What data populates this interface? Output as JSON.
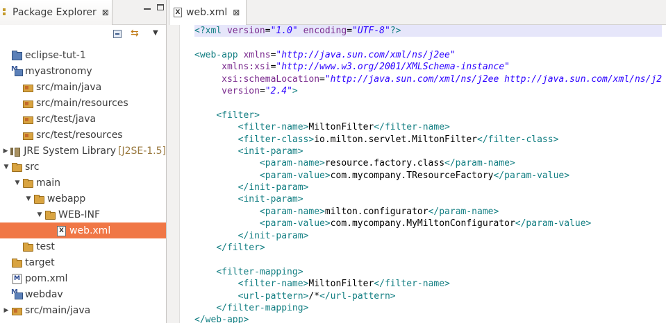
{
  "explorer": {
    "title": "Package Explorer",
    "close": "⊠",
    "tree": [
      {
        "label": "eclipse-tut-1",
        "icon": "project-icon",
        "depth": 0,
        "arrow": "",
        "suffix": ""
      },
      {
        "label": "myastronomy",
        "icon": "maven-project-icon",
        "depth": 0,
        "arrow": "",
        "suffix": ""
      },
      {
        "label": "src/main/java",
        "icon": "source-folder-icon",
        "depth": 1,
        "arrow": "",
        "suffix": ""
      },
      {
        "label": "src/main/resources",
        "icon": "source-folder-icon",
        "depth": 1,
        "arrow": "",
        "suffix": ""
      },
      {
        "label": "src/test/java",
        "icon": "source-folder-icon",
        "depth": 1,
        "arrow": "",
        "suffix": ""
      },
      {
        "label": "src/test/resources",
        "icon": "source-folder-icon",
        "depth": 1,
        "arrow": "",
        "suffix": ""
      },
      {
        "label": "JRE System Library",
        "icon": "library-icon",
        "depth": 0,
        "arrow": "▶",
        "suffix": "[J2SE-1.5]"
      },
      {
        "label": "src",
        "icon": "folder-icon",
        "depth": 0,
        "arrow": "▼",
        "suffix": ""
      },
      {
        "label": "main",
        "icon": "folder-icon",
        "depth": 1,
        "arrow": "▼",
        "suffix": ""
      },
      {
        "label": "webapp",
        "icon": "folder-icon",
        "depth": 2,
        "arrow": "▼",
        "suffix": ""
      },
      {
        "label": "WEB-INF",
        "icon": "folder-icon",
        "depth": 3,
        "arrow": "▼",
        "suffix": ""
      },
      {
        "label": "web.xml",
        "icon": "xml-file-icon",
        "depth": 4,
        "arrow": "",
        "suffix": "",
        "selected": true
      },
      {
        "label": "test",
        "icon": "folder-icon",
        "depth": 1,
        "arrow": "",
        "suffix": ""
      },
      {
        "label": "target",
        "icon": "folder-icon",
        "depth": 0,
        "arrow": "",
        "suffix": ""
      },
      {
        "label": "pom.xml",
        "icon": "pom-file-icon",
        "depth": 0,
        "arrow": "",
        "suffix": ""
      },
      {
        "label": "webdav",
        "icon": "maven-project-icon",
        "depth": 0,
        "arrow": "",
        "suffix": ""
      },
      {
        "label": "src/main/java",
        "icon": "source-folder-icon",
        "depth": 0,
        "arrow": "▶",
        "suffix": ""
      }
    ]
  },
  "editor": {
    "tab_title": "web.xml",
    "tab_close": "⊠",
    "file_icon": "X",
    "lines": [
      [
        [
          "pi",
          "<?xml "
        ],
        [
          "attr",
          "version"
        ],
        [
          "txt",
          "="
        ],
        [
          "val",
          "\"1.0\""
        ],
        [
          "txt",
          " "
        ],
        [
          "attr",
          "encoding"
        ],
        [
          "txt",
          "="
        ],
        [
          "val",
          "\"UTF-8\""
        ],
        [
          "pi",
          "?>"
        ]
      ],
      [],
      [
        [
          "tag",
          "<web-app "
        ],
        [
          "attr",
          "xmlns"
        ],
        [
          "txt",
          "="
        ],
        [
          "val",
          "\"http://java.sun.com/xml/ns/j2ee\""
        ]
      ],
      [
        [
          "txt",
          "     "
        ],
        [
          "attr",
          "xmlns:xsi"
        ],
        [
          "txt",
          "="
        ],
        [
          "val",
          "\"http://www.w3.org/2001/XMLSchema-instance\""
        ]
      ],
      [
        [
          "txt",
          "     "
        ],
        [
          "attr",
          "xsi:schemaLocation"
        ],
        [
          "txt",
          "="
        ],
        [
          "val",
          "\"http://java.sun.com/xml/ns/j2ee http://java.sun.com/xml/ns/j2"
        ]
      ],
      [
        [
          "txt",
          "     "
        ],
        [
          "attr",
          "version"
        ],
        [
          "txt",
          "="
        ],
        [
          "val",
          "\"2.4\""
        ],
        [
          "tag",
          ">"
        ]
      ],
      [],
      [
        [
          "txt",
          "    "
        ],
        [
          "tag",
          "<filter>"
        ]
      ],
      [
        [
          "txt",
          "        "
        ],
        [
          "tag",
          "<filter-name>"
        ],
        [
          "txt",
          "MiltonFilter"
        ],
        [
          "tag",
          "</filter-name>"
        ]
      ],
      [
        [
          "txt",
          "        "
        ],
        [
          "tag",
          "<filter-class>"
        ],
        [
          "txt",
          "io.milton.servlet.MiltonFilter"
        ],
        [
          "tag",
          "</filter-class>"
        ]
      ],
      [
        [
          "txt",
          "        "
        ],
        [
          "tag",
          "<init-param>"
        ]
      ],
      [
        [
          "txt",
          "            "
        ],
        [
          "tag",
          "<param-name>"
        ],
        [
          "txt",
          "resource.factory.class"
        ],
        [
          "tag",
          "</param-name>"
        ]
      ],
      [
        [
          "txt",
          "            "
        ],
        [
          "tag",
          "<param-value>"
        ],
        [
          "txt",
          "com.mycompany.TResourceFactory"
        ],
        [
          "tag",
          "</param-value>"
        ]
      ],
      [
        [
          "txt",
          "        "
        ],
        [
          "tag",
          "</init-param>"
        ]
      ],
      [
        [
          "txt",
          "        "
        ],
        [
          "tag",
          "<init-param>"
        ]
      ],
      [
        [
          "txt",
          "            "
        ],
        [
          "tag",
          "<param-name>"
        ],
        [
          "txt",
          "milton.configurator"
        ],
        [
          "tag",
          "</param-name>"
        ]
      ],
      [
        [
          "txt",
          "            "
        ],
        [
          "tag",
          "<param-value>"
        ],
        [
          "txt",
          "com.mycompany.MyMiltonConfigurator"
        ],
        [
          "tag",
          "</param-value>"
        ]
      ],
      [
        [
          "txt",
          "        "
        ],
        [
          "tag",
          "</init-param>"
        ]
      ],
      [
        [
          "txt",
          "    "
        ],
        [
          "tag",
          "</filter>"
        ]
      ],
      [],
      [
        [
          "txt",
          "    "
        ],
        [
          "tag",
          "<filter-mapping>"
        ]
      ],
      [
        [
          "txt",
          "        "
        ],
        [
          "tag",
          "<filter-name>"
        ],
        [
          "txt",
          "MiltonFilter"
        ],
        [
          "tag",
          "</filter-name>"
        ]
      ],
      [
        [
          "txt",
          "        "
        ],
        [
          "tag",
          "<url-pattern>"
        ],
        [
          "txt",
          "/*"
        ],
        [
          "tag",
          "</url-pattern>"
        ]
      ],
      [
        [
          "txt",
          "    "
        ],
        [
          "tag",
          "</filter-mapping>"
        ]
      ],
      [
        [
          "tag",
          "</web-app>"
        ]
      ]
    ]
  }
}
